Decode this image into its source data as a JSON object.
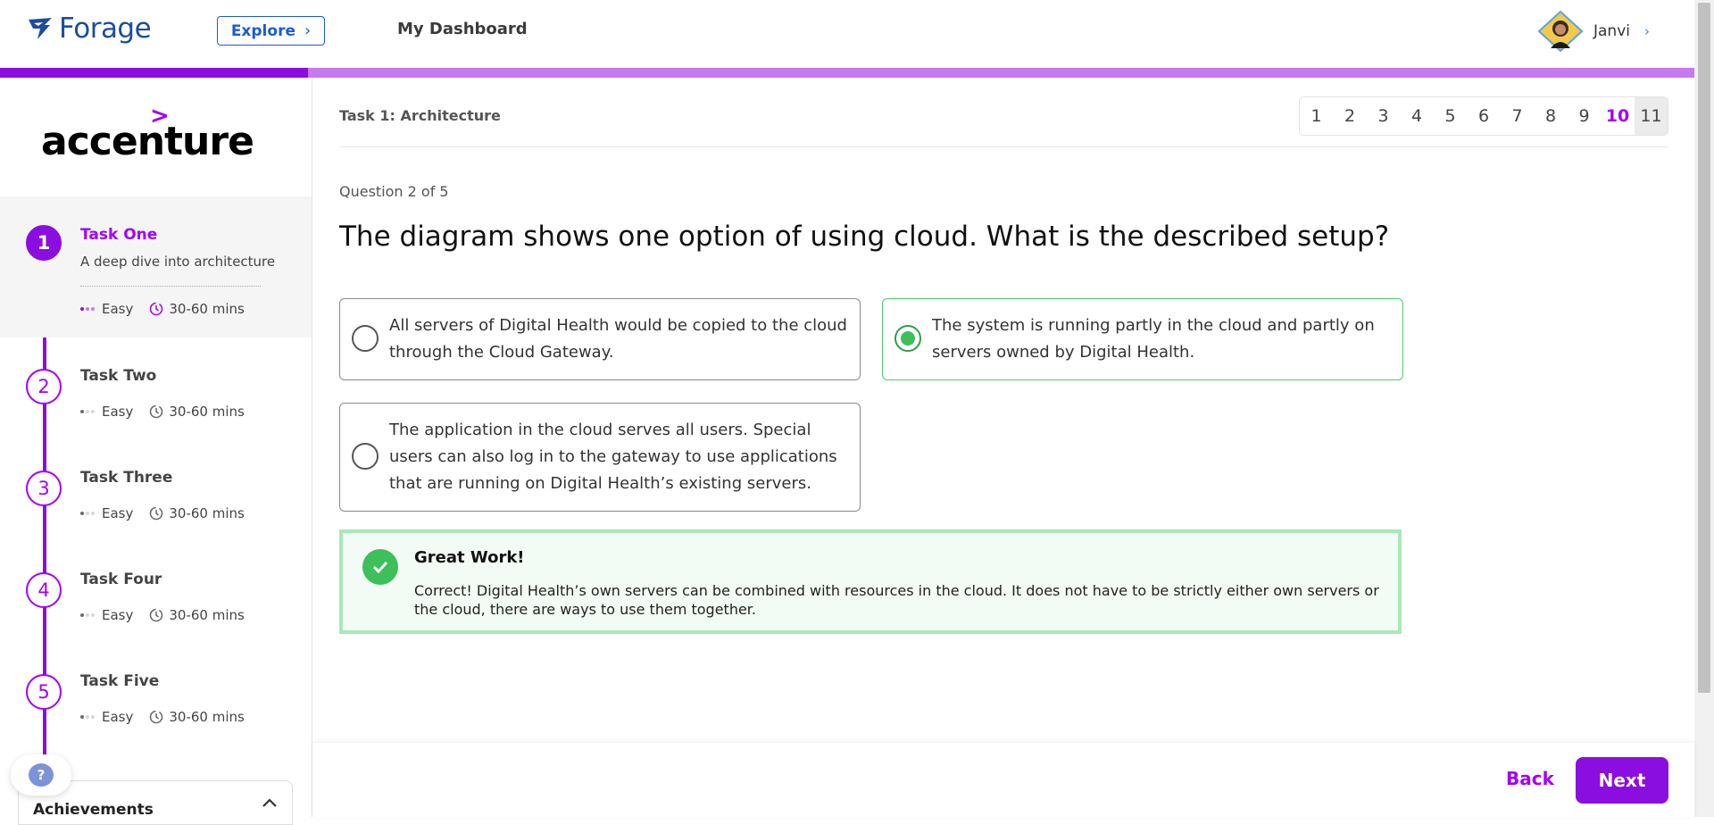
{
  "header": {
    "logo_text": "Forage",
    "explore_label": "Explore",
    "dashboard_label": "My Dashboard",
    "user_name": "Janvi"
  },
  "progress": {
    "fraction": 0.182
  },
  "colors": {
    "accent": "#8b0ee0",
    "accent_light": "#c779f0",
    "brand_blue": "#1d4e9c",
    "success": "#3dbf5b"
  },
  "sidebar": {
    "brand_text": "accenture",
    "brand_mark": ">",
    "tasks": [
      {
        "num": "1",
        "title": "Task One",
        "desc": "A deep dive into architecture",
        "difficulty": "Easy",
        "duration": "30-60 mins"
      },
      {
        "num": "2",
        "title": "Task Two",
        "difficulty": "Easy",
        "duration": "30-60 mins"
      },
      {
        "num": "3",
        "title": "Task Three",
        "difficulty": "Easy",
        "duration": "30-60 mins"
      },
      {
        "num": "4",
        "title": "Task Four",
        "difficulty": "Easy",
        "duration": "30-60 mins"
      },
      {
        "num": "5",
        "title": "Task Five",
        "difficulty": "Easy",
        "duration": "30-60 mins"
      }
    ],
    "help_label": "?",
    "achievements_label": "Achievements"
  },
  "main": {
    "task_label": "Task 1: Architecture",
    "pages": [
      "1",
      "2",
      "3",
      "4",
      "5",
      "6",
      "7",
      "8",
      "9",
      "10",
      "11"
    ],
    "selected_page": "10",
    "current_page": "11",
    "question_count": "Question 2 of 5",
    "question": "The diagram shows one option of using cloud. What is the described setup?",
    "options": [
      "All servers of Digital Health would be copied to the cloud through the Cloud Gateway.",
      "The system is running partly in the cloud and partly on servers owned by Digital Health.",
      "The application in the cloud serves all users. Special users can also log in to the gateway to use applications that are running on Digital Health’s existing servers."
    ],
    "selected_option": 1,
    "feedback_title": "Great Work!",
    "feedback_body": "Correct! Digital Health’s own servers can be combined with resources in the cloud. It does not have to be strictly either own servers or the cloud, there are ways to use them together."
  },
  "footer": {
    "back_label": "Back",
    "next_label": "Next"
  }
}
